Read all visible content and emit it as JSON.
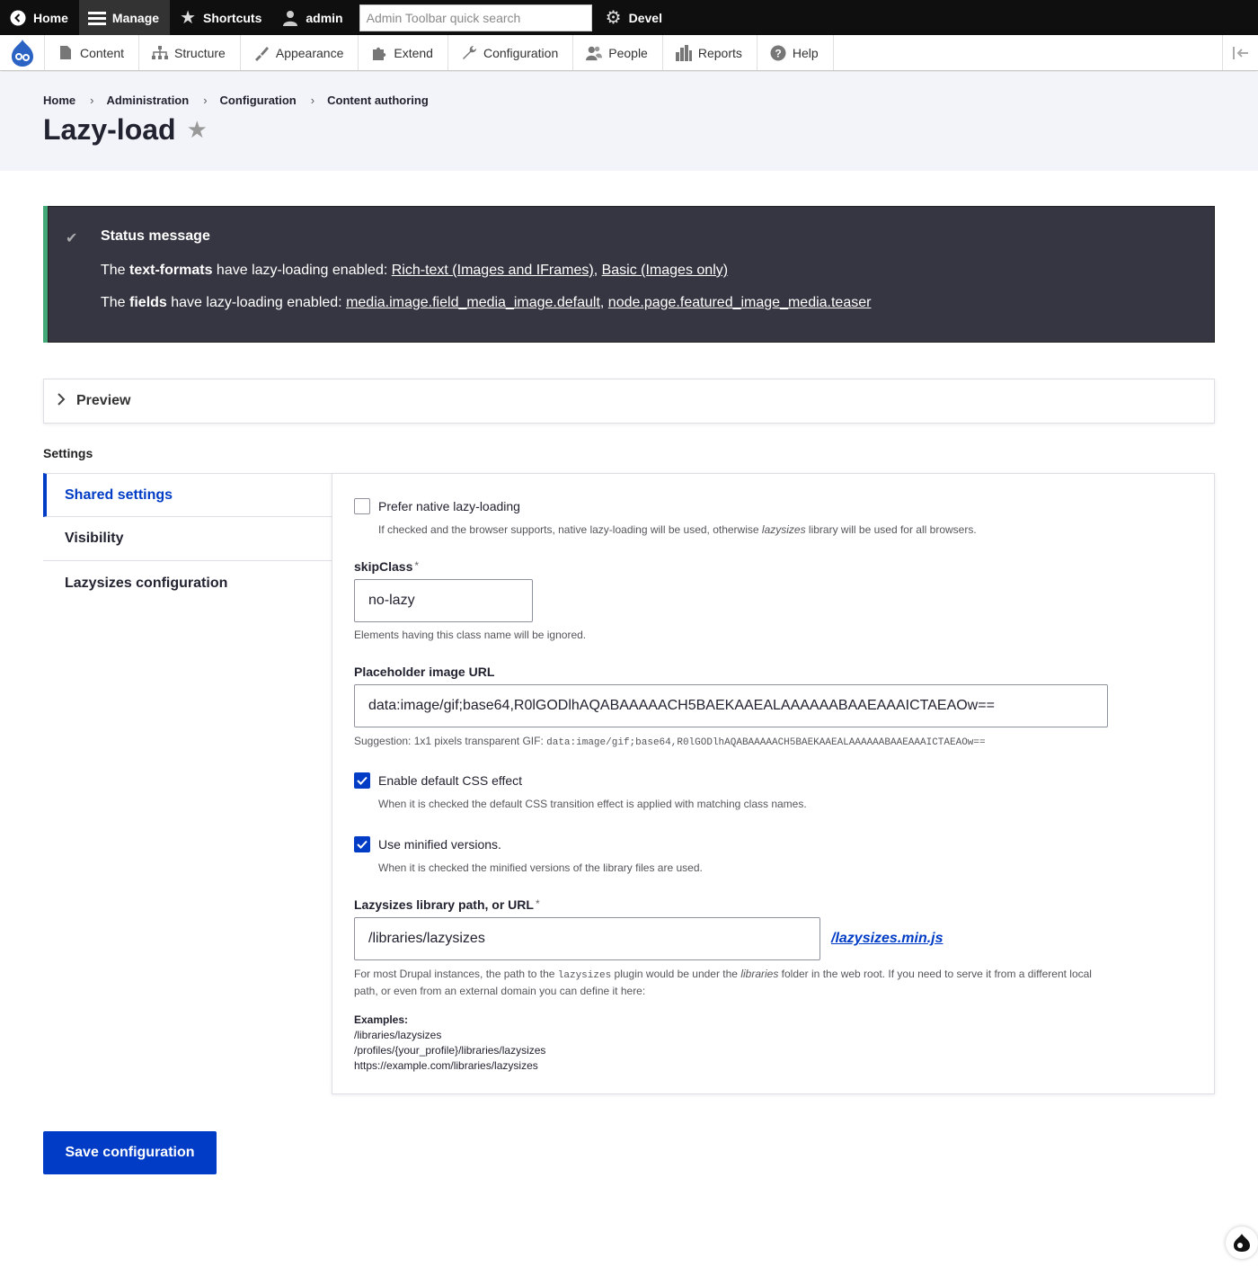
{
  "toolbar": {
    "home_label": "Home",
    "manage_label": "Manage",
    "shortcuts_label": "Shortcuts",
    "user_label": "admin",
    "search_placeholder": "Admin Toolbar quick search",
    "devel_label": "Devel"
  },
  "tray": {
    "items": [
      {
        "label": "Content",
        "icon": "file-icon"
      },
      {
        "label": "Structure",
        "icon": "sitemap-icon"
      },
      {
        "label": "Appearance",
        "icon": "brush-icon"
      },
      {
        "label": "Extend",
        "icon": "puzzle-icon"
      },
      {
        "label": "Configuration",
        "icon": "wrench-icon"
      },
      {
        "label": "People",
        "icon": "people-icon"
      },
      {
        "label": "Reports",
        "icon": "bar-chart-icon"
      },
      {
        "label": "Help",
        "icon": "help-icon"
      }
    ]
  },
  "breadcrumb": [
    "Home",
    "Administration",
    "Configuration",
    "Content authoring"
  ],
  "page": {
    "title": "Lazy-load"
  },
  "status": {
    "title": "Status message",
    "line1_prefix": "The ",
    "line1_bold": "text-formats",
    "line1_mid": " have lazy-loading enabled: ",
    "line1_link1": "Rich-text (Images and IFrames)",
    "line1_sep": ", ",
    "line1_link2": "Basic (Images only)",
    "line2_prefix": "The ",
    "line2_bold": "fields",
    "line2_mid": " have lazy-loading enabled: ",
    "line2_link1": "media.image.field_media_image.default",
    "line2_sep": ", ",
    "line2_link2": "node.page.featured_image_media.teaser"
  },
  "preview": {
    "label": "Preview"
  },
  "settings": {
    "label": "Settings"
  },
  "vtabs": [
    "Shared settings",
    "Visibility",
    "Lazysizes configuration"
  ],
  "form": {
    "native": {
      "label": "Prefer native lazy-loading",
      "checked": false,
      "desc_pre": "If checked and the browser supports, native lazy-loading will be used, otherwise ",
      "desc_em": "lazysizes",
      "desc_post": " library will be used for all browsers."
    },
    "skipclass": {
      "label": "skipClass",
      "required": "*",
      "value": "no-lazy",
      "desc": "Elements having this class name will be ignored."
    },
    "placeholder": {
      "label": "Placeholder image URL",
      "value": "data:image/gif;base64,R0lGODlhAQABAAAAACH5BAEKAAEALAAAAAABAAEAAAICTAEAOw==",
      "desc_pre": "Suggestion: 1x1 pixels transparent GIF: ",
      "desc_code": "data:image/gif;base64,R0lGODlhAQABAAAAACH5BAEKAAEALAAAAAABAAEAAAICTAEAOw=="
    },
    "css_effect": {
      "label": "Enable default CSS effect",
      "checked": true,
      "desc": "When it is checked the default CSS transition effect is applied with matching class names."
    },
    "minified": {
      "label": "Use minified versions.",
      "checked": true,
      "desc": "When it is checked the minified versions of the library files are used."
    },
    "libpath": {
      "label": "Lazysizes library path, or URL",
      "required": "*",
      "value": "/libraries/lazysizes",
      "suffix_link": "/lazysizes.min.js",
      "desc1_pre": "For most Drupal instances, the path to the ",
      "desc1_code": "lazysizes",
      "desc1_mid": " plugin would be under the ",
      "desc1_em": "libraries",
      "desc1_post": " folder in the web root. If you need to serve it from a different local",
      "desc2": "path, or even from an external domain you can define it here:",
      "examples_label": "Examples:",
      "examples": [
        "/libraries/lazysizes",
        "/profiles/{your_profile}/libraries/lazysizes",
        "https://example.com/libraries/lazysizes"
      ]
    }
  },
  "actions": {
    "save_label": "Save configuration"
  },
  "colors": {
    "accent": "#003cc5",
    "status_bg": "#353641",
    "header_bg": "#f3f4f9"
  }
}
